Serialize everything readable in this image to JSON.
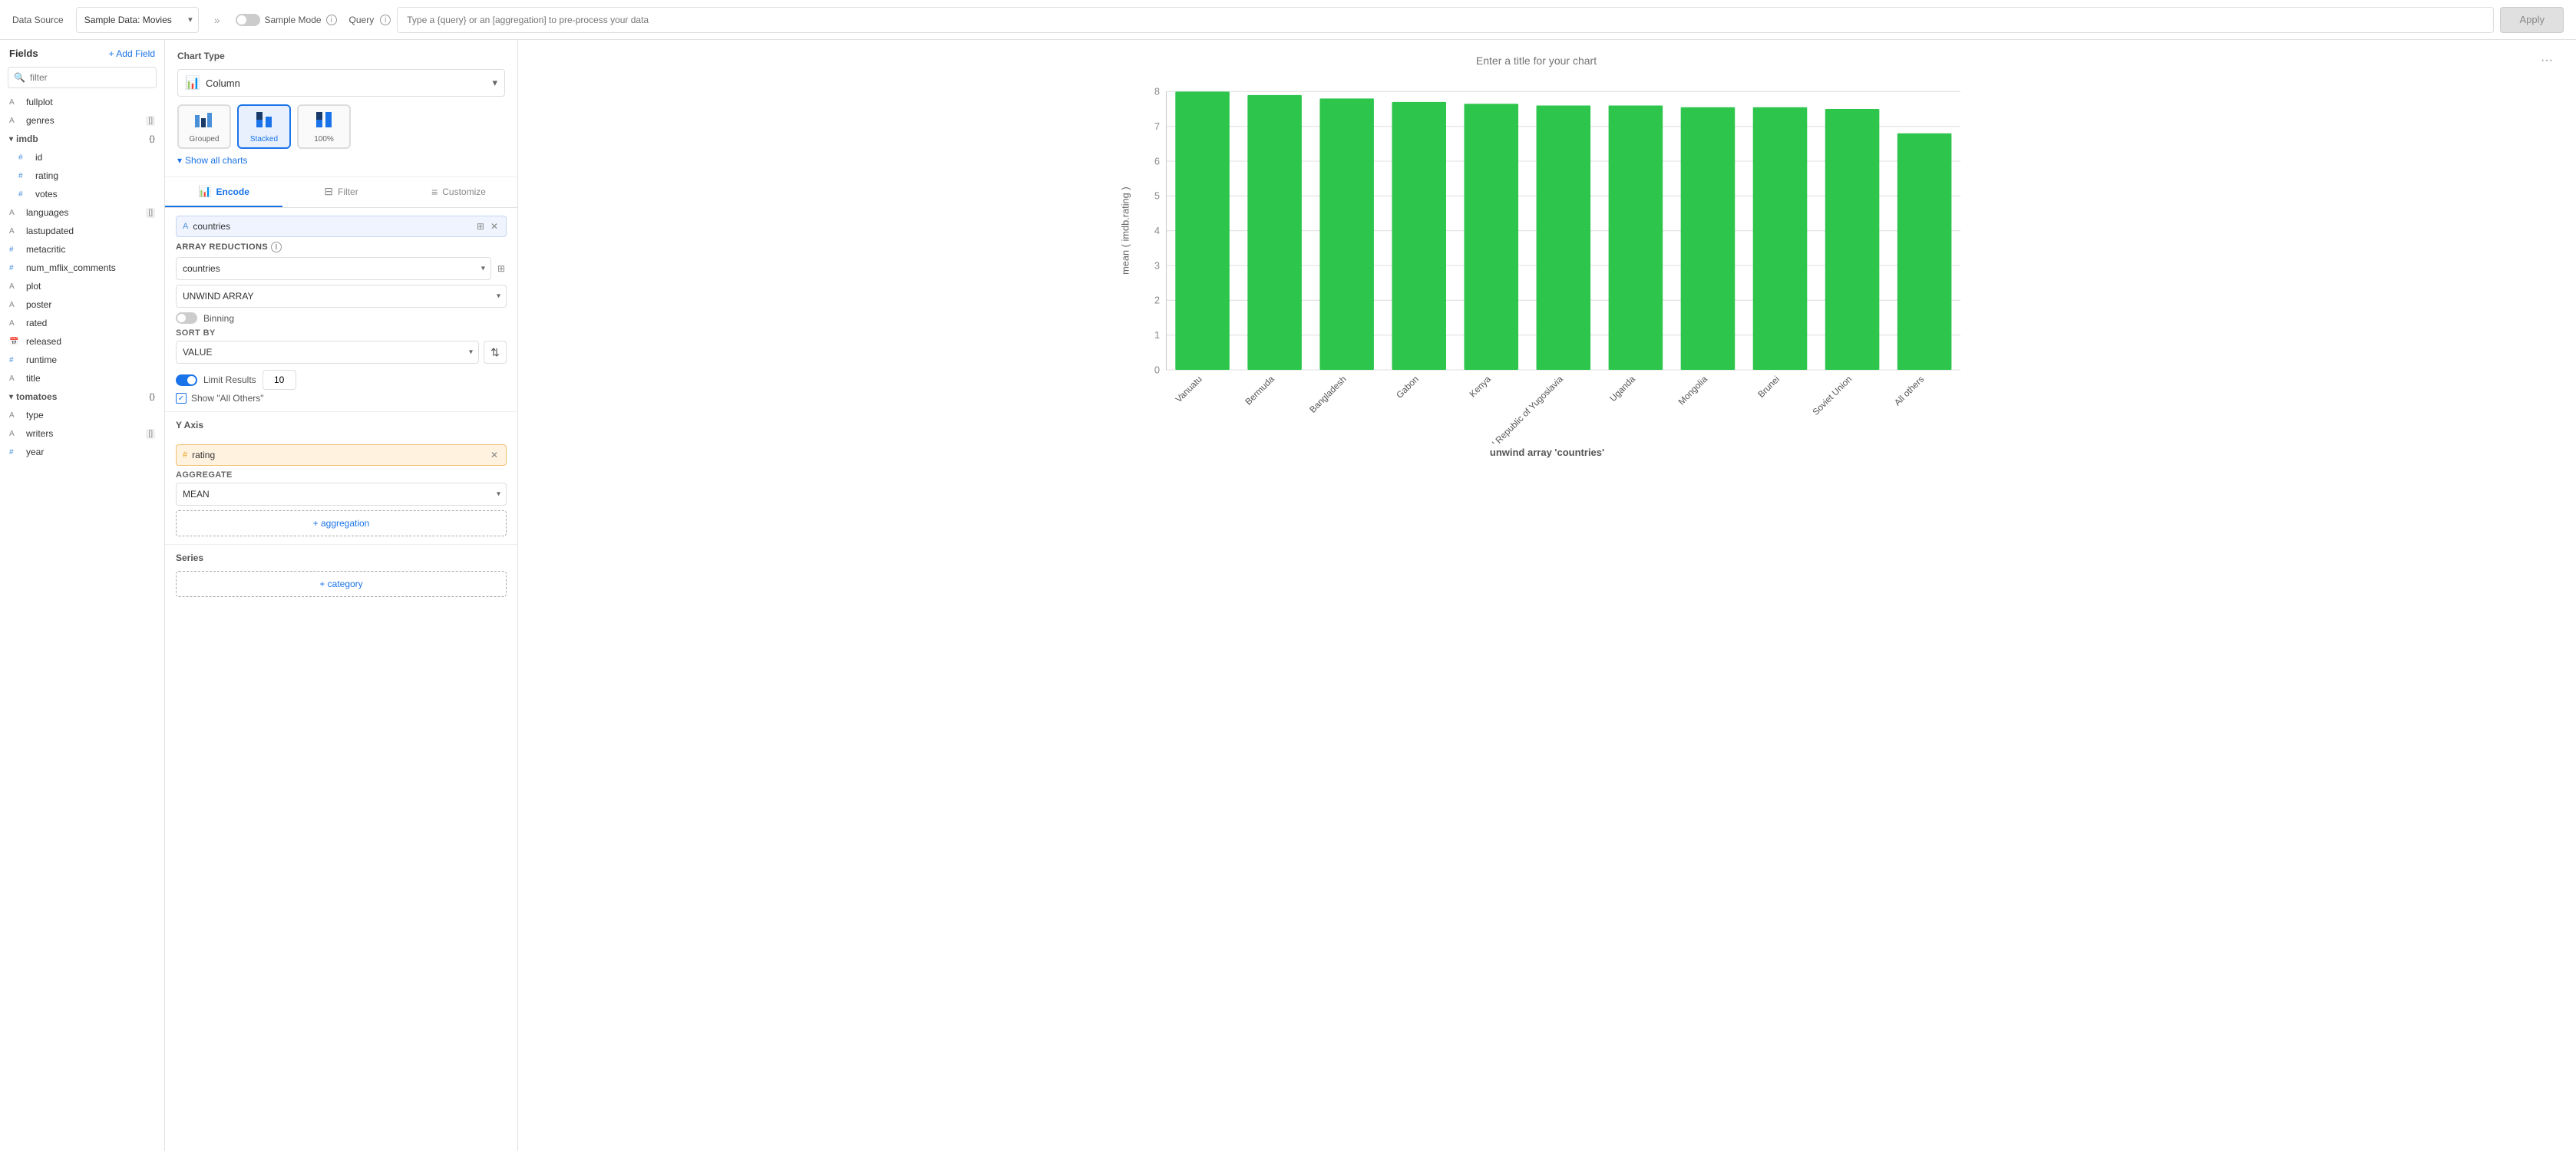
{
  "topbar": {
    "datasource_label": "Data Source",
    "sample_mode_label": "Sample Mode",
    "query_label": "Query",
    "query_placeholder": "Type a {query} or an [aggregation] to pre-process your data",
    "apply_label": "Apply",
    "datasource_value": "Sample Data: Movies"
  },
  "fields": {
    "title": "Fields",
    "add_field_label": "+ Add Field",
    "filter_placeholder": "filter",
    "items": [
      {
        "name": "fullplot",
        "type": "A",
        "badge": ""
      },
      {
        "name": "genres",
        "type": "A",
        "badge": "[]"
      },
      {
        "name": "imdb",
        "type": "group",
        "badge": "{}"
      },
      {
        "name": "id",
        "type": "#",
        "badge": "",
        "indent": true
      },
      {
        "name": "rating",
        "type": "#",
        "badge": "",
        "indent": true
      },
      {
        "name": "votes",
        "type": "#",
        "badge": "",
        "indent": true
      },
      {
        "name": "languages",
        "type": "A",
        "badge": "[]"
      },
      {
        "name": "lastupdated",
        "type": "A",
        "badge": ""
      },
      {
        "name": "metacritic",
        "type": "#",
        "badge": ""
      },
      {
        "name": "num_mflix_comments",
        "type": "#",
        "badge": ""
      },
      {
        "name": "plot",
        "type": "A",
        "badge": ""
      },
      {
        "name": "poster",
        "type": "A",
        "badge": ""
      },
      {
        "name": "rated",
        "type": "A",
        "badge": ""
      },
      {
        "name": "released",
        "type": "cal",
        "badge": ""
      },
      {
        "name": "runtime",
        "type": "#",
        "badge": ""
      },
      {
        "name": "title",
        "type": "A",
        "badge": ""
      },
      {
        "name": "tomatoes",
        "type": "group",
        "badge": "{}"
      },
      {
        "name": "type",
        "type": "A",
        "badge": ""
      },
      {
        "name": "writers",
        "type": "A",
        "badge": "[]"
      },
      {
        "name": "year",
        "type": "#",
        "badge": ""
      }
    ]
  },
  "config": {
    "chart_type_label": "Chart Type",
    "chart_type_value": "Column",
    "variants": [
      {
        "id": "grouped",
        "label": "Grouped",
        "active": false
      },
      {
        "id": "stacked",
        "label": "Stacked",
        "active": true
      },
      {
        "id": "100pct",
        "label": "100%",
        "active": false
      }
    ],
    "show_all_charts": "Show all charts",
    "tabs": [
      {
        "id": "encode",
        "label": "Encode",
        "active": true
      },
      {
        "id": "filter",
        "label": "Filter",
        "active": false
      },
      {
        "id": "customize",
        "label": "Customize",
        "active": false
      }
    ],
    "x_field": "countries",
    "array_reductions_label": "ARRAY REDUCTIONS",
    "array_field": "countries",
    "array_reduction_value": "UNWIND ARRAY",
    "binning_label": "Binning",
    "sort_by_label": "SORT BY",
    "sort_value": "VALUE",
    "limit_label": "Limit Results",
    "limit_value": "10",
    "show_others_label": "Show \"All Others\"",
    "y_axis_label": "Y Axis",
    "y_field": "rating",
    "aggregate_label": "AGGREGATE",
    "aggregate_value": "MEAN",
    "add_aggregation_label": "+ aggregation",
    "series_label": "Series",
    "add_category_label": "+ category"
  },
  "chart": {
    "title_placeholder": "Enter a title for your chart",
    "y_axis_label": "mean ( imdb.rating )",
    "x_axis_label": "unwind array 'countries'",
    "bars": [
      {
        "label": "Vanuatu",
        "value": 8.0,
        "pct": 100
      },
      {
        "label": "Bermuda",
        "value": 7.9,
        "pct": 98.75
      },
      {
        "label": "Bangladesh",
        "value": 7.8,
        "pct": 97.5
      },
      {
        "label": "Gabon",
        "value": 7.7,
        "pct": 96.25
      },
      {
        "label": "Kenya",
        "value": 7.65,
        "pct": 95.6
      },
      {
        "label": "Federal Republic of Yugoslavia",
        "value": 7.6,
        "pct": 95
      },
      {
        "label": "Uganda",
        "value": 7.6,
        "pct": 95
      },
      {
        "label": "Mongolia",
        "value": 7.55,
        "pct": 94.4
      },
      {
        "label": "Brunei",
        "value": 7.55,
        "pct": 94.4
      },
      {
        "label": "Soviet Union",
        "value": 7.5,
        "pct": 93.75
      },
      {
        "label": "All others",
        "value": 6.8,
        "pct": 85
      }
    ],
    "y_ticks": [
      "0",
      "1",
      "2",
      "3",
      "4",
      "5",
      "6",
      "7",
      "8"
    ],
    "bar_color": "#2DC54C"
  }
}
